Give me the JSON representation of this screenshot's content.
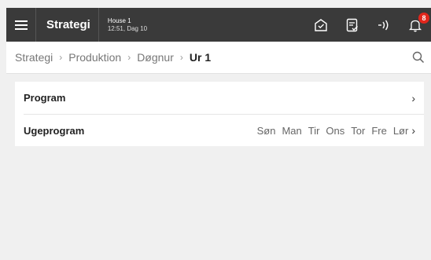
{
  "topbar": {
    "title": "Strategi",
    "house_name": "House 1",
    "house_time": "12:51, Dag 10",
    "notification_count": "8",
    "bg_color": "#3a3a3a"
  },
  "breadcrumb": {
    "items": [
      "Strategi",
      "Produktion",
      "Døgnur"
    ],
    "current": "Ur 1"
  },
  "list": {
    "program_label": "Program",
    "weekprogram_label": "Ugeprogram",
    "days": [
      "Søn",
      "Man",
      "Tir",
      "Ons",
      "Tor",
      "Fre",
      "Lør"
    ]
  },
  "icons": [
    "menu-icon",
    "house-check-icon",
    "document-check-icon",
    "signal-waves-icon",
    "bell-icon",
    "search-icon",
    "chevron-right-icon"
  ],
  "colors": {
    "badge": "#e1261c"
  }
}
